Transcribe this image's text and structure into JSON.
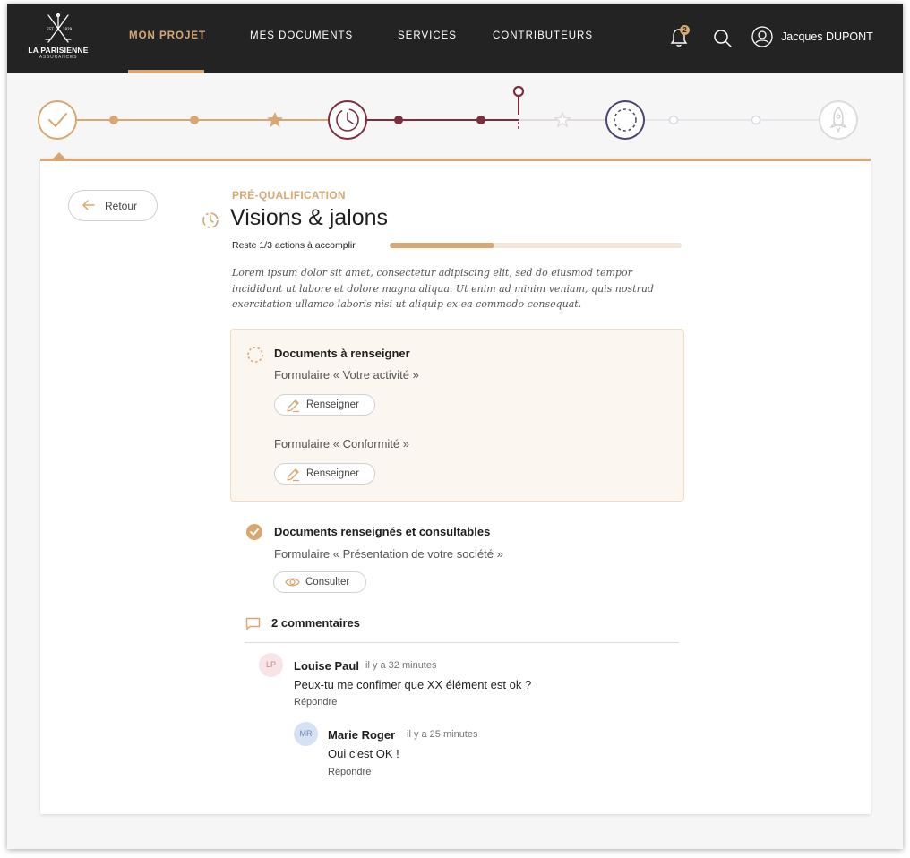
{
  "brand": {
    "name": "LA PARISIENNE",
    "sub": "ASSURANCES",
    "est_left": "EST.",
    "est_right": "1829"
  },
  "nav": {
    "items": [
      {
        "label": "MON PROJET",
        "active": true
      },
      {
        "label": "MES DOCUMENTS",
        "active": false
      },
      {
        "label": "SERVICES",
        "active": false
      },
      {
        "label": "CONTRIBUTEURS",
        "active": false
      }
    ],
    "notification_count": "2",
    "user_name": "Jacques DUPONT"
  },
  "stepper": {
    "milestones": [
      "done",
      "in-progress",
      "upcoming",
      "launch"
    ],
    "current_marker": "location-pin"
  },
  "back": {
    "label": "Retour"
  },
  "header": {
    "eyebrow": "PRÉ-QUALIFICATION",
    "title": "Visions & jalons",
    "progress_label": "Reste 1/3 actions à accomplir",
    "progress_fraction": 0.36,
    "lead": "Lorem ipsum dolor sit amet, consectetur adipiscing elit, sed do eiusmod tempor incididunt ut labore et dolore magna aliqua. Ut enim ad minim veniam, quis nostrud exercitation ullamco laboris nisi ut aliquip ex ea commodo consequat."
  },
  "todo": {
    "title": "Documents à renseigner",
    "forms": [
      {
        "name": "Formulaire « Votre activité »",
        "action": "Renseigner"
      },
      {
        "name": "Formulaire « Conformité »",
        "action": "Renseigner"
      }
    ]
  },
  "done": {
    "title": "Documents renseignés et consultables",
    "forms": [
      {
        "name": "Formulaire « Présentation de votre société »",
        "action": "Consulter"
      }
    ]
  },
  "comments": {
    "count_label": "2 commentaires",
    "items": [
      {
        "initials": "LP",
        "author": "Louise Paul",
        "time": "il y a 32 minutes",
        "text": "Peux-tu me confimer que XX élément est ok ?",
        "reply": "Répondre"
      },
      {
        "initials": "MR",
        "author": "Marie Roger",
        "time": "il y a 25 minutes",
        "text": "Oui c'est OK !",
        "reply": "Répondre"
      }
    ]
  },
  "colors": {
    "accent": "#d8a874",
    "burgundy": "#7d2e3e",
    "violet": "#4a4470",
    "muted": "#e3d9df",
    "topbar": "#232323"
  }
}
